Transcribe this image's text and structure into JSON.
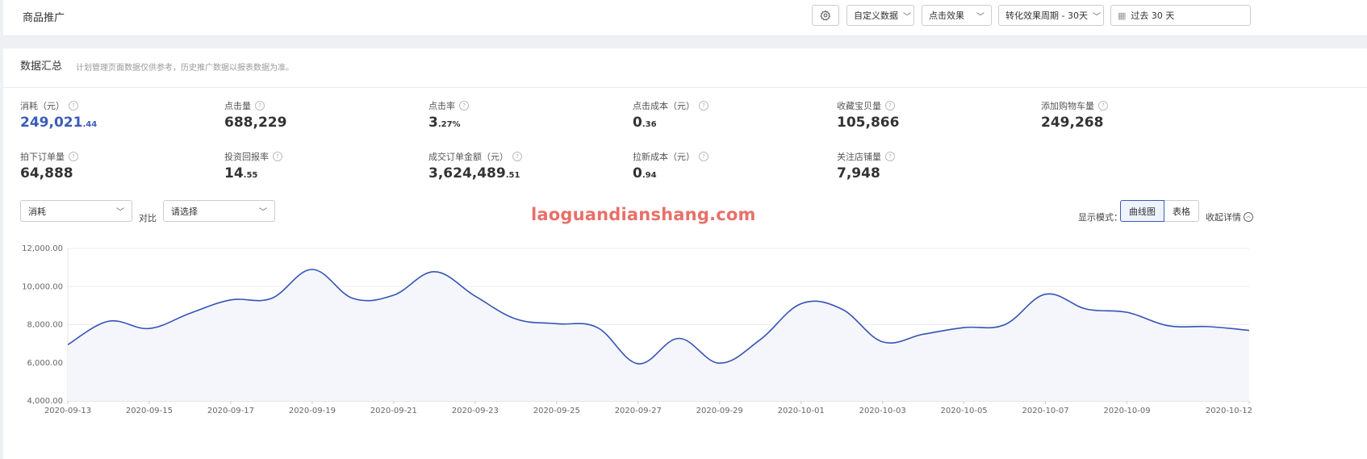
{
  "topbar": {
    "title": "商品推广",
    "custom_data_label": "自定义数据",
    "click_effect_label": "点击效果",
    "conversion_period_label": "转化效果周期 - 30天",
    "date_range_label": "过去 30 天"
  },
  "summary": {
    "title": "数据汇总",
    "note": "计划管理页面数据仅供参考，历史推广数据以报表数据为准。"
  },
  "metrics": [
    {
      "label": "消耗（元）",
      "int": "249,021",
      "dec": ".44"
    },
    {
      "label": "点击量",
      "int": "688,229",
      "dec": ""
    },
    {
      "label": "点击率",
      "int": "3",
      "dec": ".27%"
    },
    {
      "label": "点击成本（元）",
      "int": "0",
      "dec": ".36"
    },
    {
      "label": "收藏宝贝量",
      "int": "105,866",
      "dec": ""
    },
    {
      "label": "添加购物车量",
      "int": "249,268",
      "dec": ""
    },
    {
      "label": "拍下订单量",
      "int": "64,888",
      "dec": ""
    },
    {
      "label": "投资回报率",
      "int": "14",
      "dec": ".55"
    },
    {
      "label": "成交订单金额（元）",
      "int": "3,624,489",
      "dec": ".51"
    },
    {
      "label": "拉新成本（元）",
      "int": "0",
      "dec": ".94"
    },
    {
      "label": "关注店铺量",
      "int": "7,948",
      "dec": ""
    }
  ],
  "controls": {
    "metric_select": "消耗",
    "compare_label": "对比",
    "compare_select": "请选择",
    "display_mode_label": "显示模式：",
    "mode_chart": "曲线图",
    "mode_table": "表格",
    "collapse_label": "收起详情"
  },
  "watermark": "laoguandianshang.com",
  "colors": {
    "accent": "#3b5db8",
    "line": "#3553b5",
    "watermark": "#e8706a"
  },
  "chart_data": {
    "type": "area",
    "x": [
      "2020-09-13",
      "2020-09-14",
      "2020-09-15",
      "2020-09-16",
      "2020-09-17",
      "2020-09-18",
      "2020-09-19",
      "2020-09-20",
      "2020-09-21",
      "2020-09-22",
      "2020-09-23",
      "2020-09-24",
      "2020-09-25",
      "2020-09-26",
      "2020-09-27",
      "2020-09-28",
      "2020-09-29",
      "2020-09-30",
      "2020-10-01",
      "2020-10-02",
      "2020-10-03",
      "2020-10-04",
      "2020-10-05",
      "2020-10-06",
      "2020-10-07",
      "2020-10-08",
      "2020-10-09",
      "2020-10-10",
      "2020-10-11",
      "2020-10-12"
    ],
    "xtick_labels": [
      "2020-09-13",
      "2020-09-15",
      "2020-09-17",
      "2020-09-19",
      "2020-09-21",
      "2020-09-23",
      "2020-09-25",
      "2020-09-27",
      "2020-09-29",
      "2020-10-01",
      "2020-10-03",
      "2020-10-05",
      "2020-10-07",
      "2020-10-09",
      "2020-10-12"
    ],
    "values": [
      6950,
      8180,
      7800,
      8600,
      9300,
      9380,
      10900,
      9380,
      9550,
      10780,
      9500,
      8300,
      8050,
      7850,
      5950,
      7280,
      5980,
      7220,
      9100,
      8820,
      7100,
      7500,
      7850,
      8000,
      9600,
      8820,
      8650,
      7950,
      7900,
      7700
    ],
    "yticks": [
      "4,000.00",
      "6,000.00",
      "8,000.00",
      "10,000.00",
      "12,000.00"
    ],
    "ylim": [
      4000,
      12000
    ],
    "grid": true
  }
}
